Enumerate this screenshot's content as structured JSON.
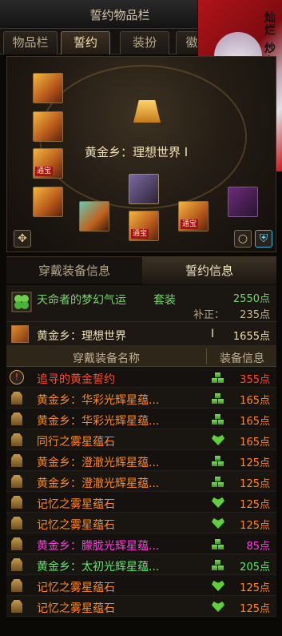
{
  "window": {
    "title": "誓约物品栏"
  },
  "tabs": [
    {
      "label": "物品栏"
    },
    {
      "label": "誓约"
    },
    {
      "label": "装扮"
    },
    {
      "label": "徽"
    }
  ],
  "portrait": {
    "text": "灿烂 炒心"
  },
  "equip": {
    "set_name": "黄金乡：理想世界 I",
    "badge": "通宝"
  },
  "info_tabs": [
    {
      "label": "穿戴装备信息"
    },
    {
      "label": "誓约信息"
    }
  ],
  "set_summary": {
    "name": "天命者的梦幻气运",
    "label": "套装",
    "points": "2550点",
    "correction_label": "补正：",
    "correction": "235点"
  },
  "sub_set": {
    "name": "黄金乡：理想世界",
    "roman": "I",
    "points": "1655点"
  },
  "columns": {
    "name": "穿戴装备名称",
    "info": "装备信息"
  },
  "rows": [
    {
      "name": "追寻的黄金誓约",
      "points": "355点",
      "color": "#ff4a2e",
      "icon": "ring-icon",
      "sym": "blocks"
    },
    {
      "name": "黄金乡：华彩光辉星蕴...",
      "points": "165点",
      "color": "#ff8a1c",
      "icon": "stone-icon",
      "sym": "blocks"
    },
    {
      "name": "黄金乡：华彩光辉星蕴...",
      "points": "165点",
      "color": "#ff8a1c",
      "icon": "stone-icon",
      "sym": "blocks"
    },
    {
      "name": "同行之雾星蕴石",
      "points": "165点",
      "color": "#ff8a1c",
      "icon": "stone-icon",
      "sym": "heart"
    },
    {
      "name": "黄金乡：澄澈光辉星蕴...",
      "points": "125点",
      "color": "#ff8a1c",
      "icon": "stone-icon",
      "sym": "blocks"
    },
    {
      "name": "黄金乡：澄澈光辉星蕴...",
      "points": "125点",
      "color": "#ff8a1c",
      "icon": "stone-icon",
      "sym": "blocks"
    },
    {
      "name": "记忆之雾星蕴石",
      "points": "125点",
      "color": "#ff8a1c",
      "icon": "stone-icon",
      "sym": "heart"
    },
    {
      "name": "记忆之雾星蕴石",
      "points": "125点",
      "color": "#ff8a1c",
      "icon": "stone-icon",
      "sym": "heart"
    },
    {
      "name": "黄金乡：朦胧光辉星蕴...",
      "points": "85点",
      "color": "#ff3de0",
      "icon": "stone-icon",
      "sym": "blocks"
    },
    {
      "name": "黄金乡：太初光辉星蕴...",
      "points": "205点",
      "color": "#5ee870",
      "icon": "stone-icon",
      "sym": "blocks"
    },
    {
      "name": "记忆之雾星蕴石",
      "points": "125点",
      "color": "#ff8a1c",
      "icon": "stone-icon",
      "sym": "heart"
    },
    {
      "name": "记忆之雾星蕴石",
      "points": "125点",
      "color": "#ff8a1c",
      "icon": "stone-icon",
      "sym": "heart"
    }
  ]
}
